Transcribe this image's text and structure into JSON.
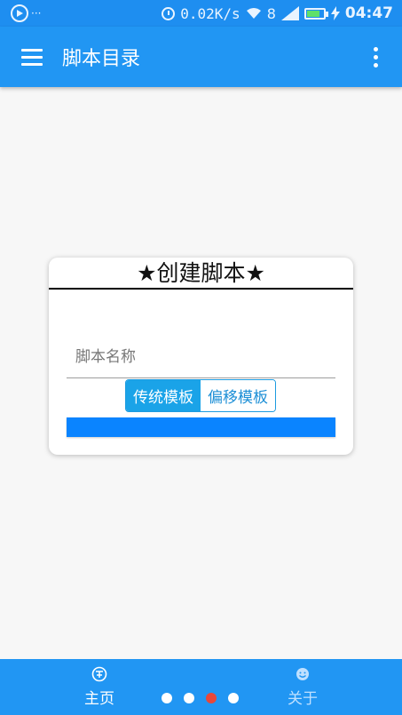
{
  "status_bar": {
    "app_indicator": "···",
    "net_speed": "0.02K/s",
    "signal_text": "8",
    "time": "04:47"
  },
  "app_bar": {
    "title": "脚本目录",
    "menu_icon": "hamburger-icon",
    "more_icon": "more-vert-icon"
  },
  "dialog": {
    "title": "★创建脚本★",
    "name_placeholder": "脚本名称",
    "name_value": "",
    "template_options": [
      {
        "label": "传统模板",
        "selected": true
      },
      {
        "label": "偏移模板",
        "selected": false
      }
    ]
  },
  "bottom_nav": {
    "items": [
      {
        "label": "主页",
        "icon": "write-icon",
        "active": true
      },
      {
        "label": "关于",
        "icon": "smiley-icon",
        "active": false
      }
    ],
    "page_dots": {
      "count": 4,
      "active_index": 2
    }
  },
  "colors": {
    "primary": "#2196f3",
    "status_bar": "#1e8ef0",
    "accent": "#1aa3e8",
    "confirm": "#0a84ff",
    "dot_active": "#e8473a",
    "background": "#f7f7f7"
  }
}
